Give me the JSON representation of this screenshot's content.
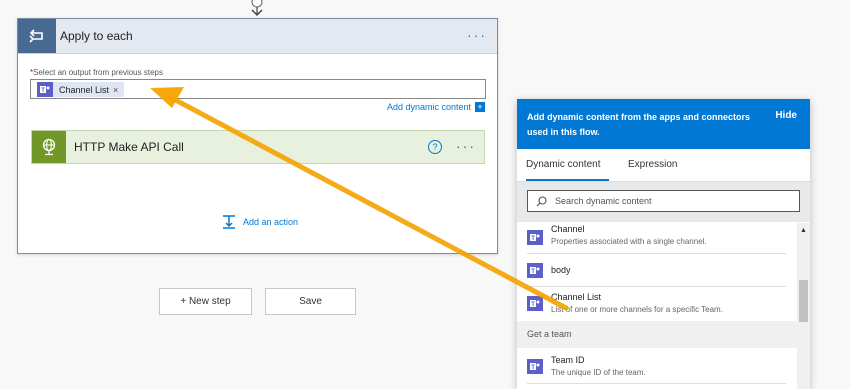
{
  "loop_card": {
    "title": "Apply to each",
    "menu": "···",
    "field_label_required": "*",
    "field_label": "Select an output from previous steps",
    "token_label": "Channel List",
    "token_remove": "×",
    "add_dynamic_label": "Add dynamic content",
    "add_dynamic_plus": "+",
    "inner_action": {
      "title": "HTTP Make API Call",
      "help": "?",
      "menu": "···"
    },
    "add_action_label": "Add an action"
  },
  "buttons": {
    "new_step": "+ New step",
    "save": "Save"
  },
  "dynamic_panel": {
    "header_text": "Add dynamic content from the apps and connectors used in this flow.",
    "hide_label": "Hide",
    "tabs": [
      "Dynamic content",
      "Expression"
    ],
    "active_tab": "Dynamic content",
    "search_placeholder": "Search dynamic content",
    "items": [
      {
        "title": "Channel",
        "subtitle": "Properties associated with a single channel."
      },
      {
        "title": "body",
        "subtitle": ""
      },
      {
        "title": "Channel List",
        "subtitle": "List of one or more channels for a specific Team."
      }
    ],
    "group_header": "Get a team",
    "group_items": [
      {
        "title": "Team ID",
        "subtitle": "The unique ID of the team."
      }
    ]
  },
  "colors": {
    "accent": "#0078d4",
    "loop_icon_bg": "#486991",
    "http_icon_bg": "#709727",
    "teams_icon_bg": "#5b5fc7",
    "arrow": "#f5a300"
  },
  "icons": {
    "loop": "loop-icon",
    "http": "globe-icon",
    "teams": "teams-icon",
    "search": "search-icon",
    "add_action": "add-action-icon"
  }
}
